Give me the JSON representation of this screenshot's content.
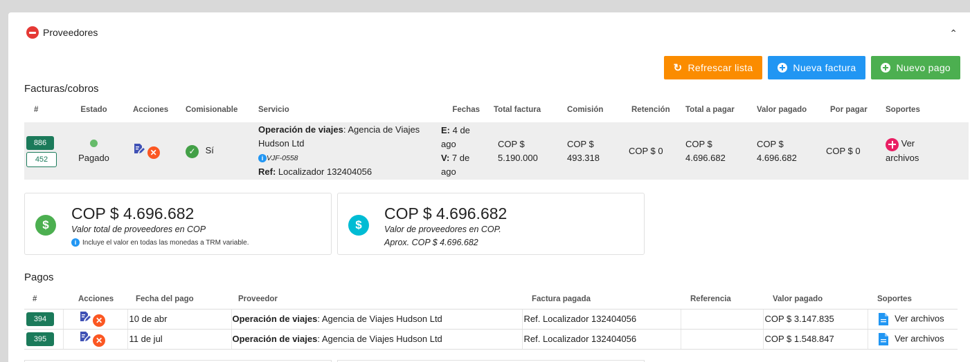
{
  "section": {
    "title": "Proveedores"
  },
  "actions": {
    "refresh_label": "Refrescar lista",
    "new_invoice_label": "Nueva factura",
    "new_payment_label": "Nuevo pago"
  },
  "invoices": {
    "title": "Facturas/cobros",
    "headers": [
      "#",
      "Estado",
      "Acciones",
      "Comisionable",
      "Servicio",
      "Fechas",
      "Total factura",
      "Comisión",
      "Retención",
      "Total a pagar",
      "Valor pagado",
      "Por pagar",
      "Soportes"
    ],
    "row": {
      "id": "886",
      "sub_id": "452",
      "status": "Pagado",
      "commissionable": "Sí",
      "service_type": "Operación de viajes",
      "service_provider": ": Agencia de Viajes Hudson Ltd",
      "service_code": "VJF-0558",
      "ref_label": "Ref:",
      "ref_value": " Localizador 132404056",
      "date_e_label": "E:",
      "date_e_value": " 4 de ago",
      "date_v_label": "V:",
      "date_v_value": " 7 de ago",
      "total_factura": "COP $ 5.190.000",
      "comision": "COP $ 493.318",
      "retencion": "COP $ 0",
      "total_pagar": "COP $ 4.696.682",
      "valor_pagado": "COP $ 4.696.682",
      "por_pagar": "COP $ 0",
      "soportes": "Ver archivos"
    }
  },
  "summary": [
    {
      "value": "COP $ 4.696.682",
      "label": "Valor total de proveedores en COP",
      "note": "Incluye el valor en todas las monedas a TRM variable."
    },
    {
      "value": "COP $ 4.696.682",
      "label": "Valor de proveedores en COP.",
      "approx": "Aprox. COP $ 4.696.682"
    }
  ],
  "payments": {
    "title": "Pagos",
    "headers": [
      "#",
      "Acciones",
      "Fecha del pago",
      "Proveedor",
      "Factura pagada",
      "Referencia",
      "Valor pagado",
      "Soportes"
    ],
    "rows": [
      {
        "id": "394",
        "date": "10 de abr",
        "provider_type": "Operación de viajes",
        "provider_name": ": Agencia de Viajes Hudson Ltd",
        "invoice": "Ref. Localizador 132404056",
        "reference": "",
        "amount": "COP $ 3.147.835",
        "files": "Ver archivos"
      },
      {
        "id": "395",
        "date": "11 de jul",
        "provider_type": "Operación de viajes",
        "provider_name": ": Agencia de Viajes Hudson Ltd",
        "invoice": "Ref. Localizador 132404056",
        "reference": "",
        "amount": "COP $ 1.548.847",
        "files": "Ver archivos"
      }
    ]
  },
  "colors": {
    "green": "#4caf50",
    "orange": "#fb8c00",
    "blue": "#2196f3",
    "teal": "#1b7a5a",
    "red": "#e53935"
  }
}
